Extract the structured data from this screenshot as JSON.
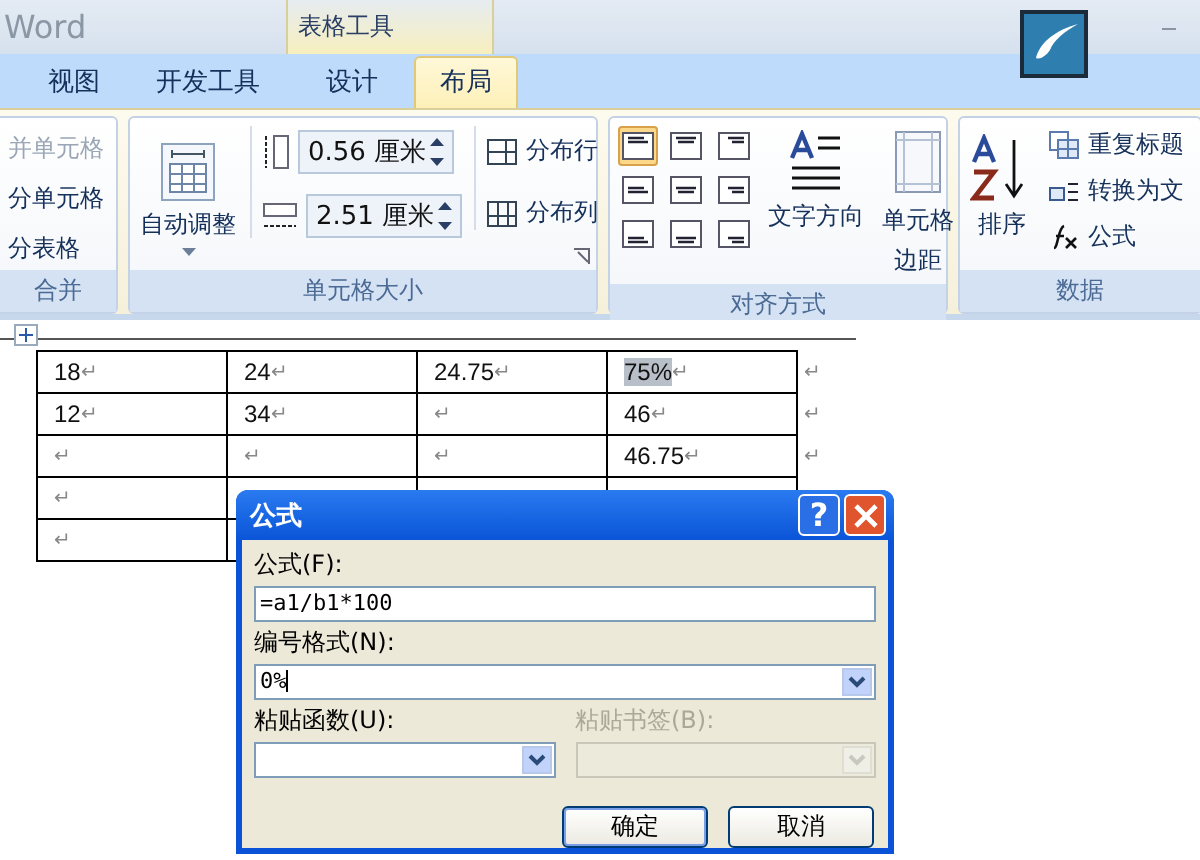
{
  "title_bar": {
    "app_title": "Word",
    "contextual_group": "表格工具"
  },
  "tabs": [
    {
      "label": "视图",
      "selected": false
    },
    {
      "label": "开发工具",
      "selected": false
    },
    {
      "label": "设计",
      "selected": false
    },
    {
      "label": "布局",
      "selected": true
    }
  ],
  "ribbon": {
    "groups": [
      {
        "kind": "merge",
        "label": "合并",
        "items": [
          {
            "label": "并单元格",
            "disabled": true
          },
          {
            "label": "分单元格",
            "disabled": false
          },
          {
            "label": "分表格",
            "disabled": false
          }
        ]
      },
      {
        "kind": "cell_size",
        "label": "单元格大小",
        "autofit": {
          "label": "自动调整"
        },
        "height": {
          "value": "0.56 厘米"
        },
        "width": {
          "value": "2.51 厘米"
        },
        "distribute": [
          {
            "label": "分布行"
          },
          {
            "label": "分布列"
          }
        ]
      },
      {
        "kind": "alignment",
        "label": "对齐方式",
        "alignments": [
          {
            "selected": true
          },
          {
            "selected": false
          },
          {
            "selected": false
          },
          {
            "selected": false
          },
          {
            "selected": false
          },
          {
            "selected": false
          },
          {
            "selected": false
          },
          {
            "selected": false
          },
          {
            "selected": false
          }
        ],
        "buttons": [
          {
            "label": "文字方向"
          },
          {
            "label": "单元格边距"
          }
        ]
      },
      {
        "kind": "data",
        "label": "数据",
        "sort": {
          "label": "排序"
        },
        "items": [
          {
            "label": "重复标题"
          },
          {
            "label": "转换为文"
          },
          {
            "label": "公式"
          }
        ]
      }
    ]
  },
  "table": {
    "rows": [
      {
        "cells": [
          {
            "text": "18",
            "para_mark": "↵",
            "highlighted": false
          },
          {
            "text": "24",
            "para_mark": "↵",
            "highlighted": false
          },
          {
            "text": "24.75",
            "para_mark": "↵",
            "highlighted": false
          },
          {
            "text": "75%",
            "para_mark": "↵",
            "highlighted": true
          }
        ],
        "end_mark": "↵"
      },
      {
        "cells": [
          {
            "text": "12",
            "para_mark": "↵",
            "highlighted": false
          },
          {
            "text": "34",
            "para_mark": "↵",
            "highlighted": false
          },
          {
            "para_mark": "↵",
            "highlighted": false
          },
          {
            "text": "46",
            "para_mark": "↵",
            "highlighted": false
          }
        ],
        "end_mark": "↵"
      },
      {
        "cells": [
          {
            "para_mark": "↵",
            "highlighted": false
          },
          {
            "para_mark": "↵",
            "highlighted": false
          },
          {
            "para_mark": "↵",
            "highlighted": false
          },
          {
            "text": "46.75",
            "para_mark": "↵",
            "highlighted": false
          }
        ],
        "end_mark": "↵"
      },
      {
        "cells": [
          {
            "para_mark": "↵",
            "highlighted": false
          }
        ]
      },
      {
        "cells": [
          {
            "para_mark": "↵",
            "highlighted": false
          }
        ]
      }
    ]
  },
  "dialog": {
    "title": "公式",
    "help": "?",
    "formula": {
      "label": "公式(F):",
      "value": "=a1/b1*100"
    },
    "number_format": {
      "label": "编号格式(N):",
      "value": "0%"
    },
    "paste_function": {
      "label": "粘贴函数(U):",
      "disabled": false
    },
    "paste_bookmark": {
      "label": "粘贴书签(B):",
      "disabled": true
    },
    "buttons": [
      {
        "label": "确定",
        "default": true
      },
      {
        "label": "取消",
        "default": false
      }
    ]
  }
}
